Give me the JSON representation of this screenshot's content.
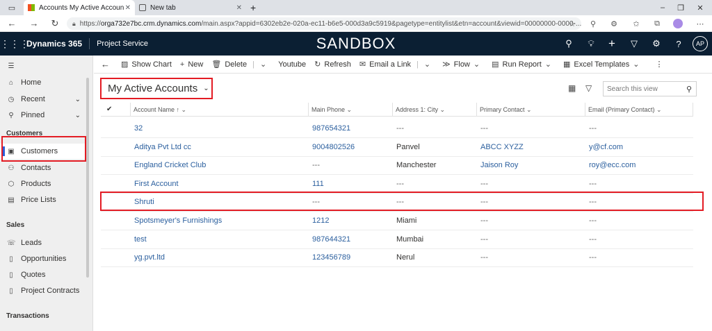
{
  "browser": {
    "tabs": [
      {
        "label": "Accounts My Active Accounts -",
        "active": true
      },
      {
        "label": "New tab",
        "active": false
      }
    ],
    "new_tab": "+",
    "url_scheme": "https://",
    "url_host": "orga732e7bc.crm.dynamics.com",
    "url_path": "/main.aspx?appid=6302eb2e-020a-ec11-b6e5-000d3a9c5919&pagetype=entitylist&etn=account&viewid=00000000-0000-...",
    "minimize": "–",
    "maximize": "❐",
    "close": "✕"
  },
  "appbar": {
    "app_name": "Dynamics 365",
    "module": "Project Service",
    "environment": "SANDBOX",
    "avatar": "AP"
  },
  "sidebar": {
    "top_items": [
      {
        "label": "Home",
        "icon": "home-icon"
      },
      {
        "label": "Recent",
        "icon": "clock-icon"
      },
      {
        "label": "Pinned",
        "icon": "pin-icon"
      }
    ],
    "sections": [
      {
        "title": "Customers",
        "items": [
          {
            "label": "Customers",
            "icon": "customers-icon",
            "selected": true
          },
          {
            "label": "Contacts",
            "icon": "person-icon"
          },
          {
            "label": "Products",
            "icon": "box-icon"
          },
          {
            "label": "Price Lists",
            "icon": "list-icon"
          }
        ]
      },
      {
        "title": "Sales",
        "items": [
          {
            "label": "Leads",
            "icon": "phone-icon"
          },
          {
            "label": "Opportunities",
            "icon": "document-icon"
          },
          {
            "label": "Quotes",
            "icon": "document-icon"
          },
          {
            "label": "Project Contracts",
            "icon": "document-icon"
          }
        ]
      },
      {
        "title": "Transactions",
        "items": []
      }
    ]
  },
  "commandbar": {
    "items": [
      {
        "label": "Show Chart",
        "icon": "chart-icon"
      },
      {
        "label": "New",
        "icon": "plus-icon"
      },
      {
        "label": "Delete",
        "icon": "trash-icon"
      },
      {
        "label": "Youtube",
        "icon": "dropdown-icon"
      },
      {
        "label": "Refresh",
        "icon": "refresh-icon"
      },
      {
        "label": "Email a Link",
        "icon": "mail-icon"
      },
      {
        "label": "Flow",
        "icon": "flow-icon"
      },
      {
        "label": "Run Report",
        "icon": "report-icon"
      },
      {
        "label": "Excel Templates",
        "icon": "excel-icon"
      }
    ]
  },
  "view": {
    "title": "My Active Accounts",
    "search_placeholder": "Search this view"
  },
  "grid": {
    "columns": [
      "Account Name",
      "Main Phone",
      "Address 1: City",
      "Primary Contact",
      "Email (Primary Contact)"
    ],
    "rows": [
      [
        "32",
        "987654321",
        "---",
        "---",
        "---"
      ],
      [
        "Aditya Pvt Ltd cc",
        "9004802526",
        "Panvel",
        "ABCC XYZZ",
        "y@cf.com"
      ],
      [
        "England Cricket Club",
        "---",
        "Manchester",
        "Jaison Roy",
        "roy@ecc.com"
      ],
      [
        "First Account",
        "111",
        "---",
        "---",
        "---"
      ],
      [
        "Shruti",
        "---",
        "---",
        "---",
        "---"
      ],
      [
        "Spotsmeyer's Furnishings",
        "1212",
        "Miami",
        "---",
        "---"
      ],
      [
        "test",
        "987644321",
        "Mumbai",
        "---",
        "---"
      ],
      [
        "yg.pvt.ltd",
        "123456789",
        "Nerul",
        "---",
        "---"
      ]
    ]
  },
  "colors": {
    "appbar": "#0b1f33",
    "link": "#2b5f9e",
    "highlight": "#e31b23",
    "selected_bar": "#2b5fd9"
  }
}
